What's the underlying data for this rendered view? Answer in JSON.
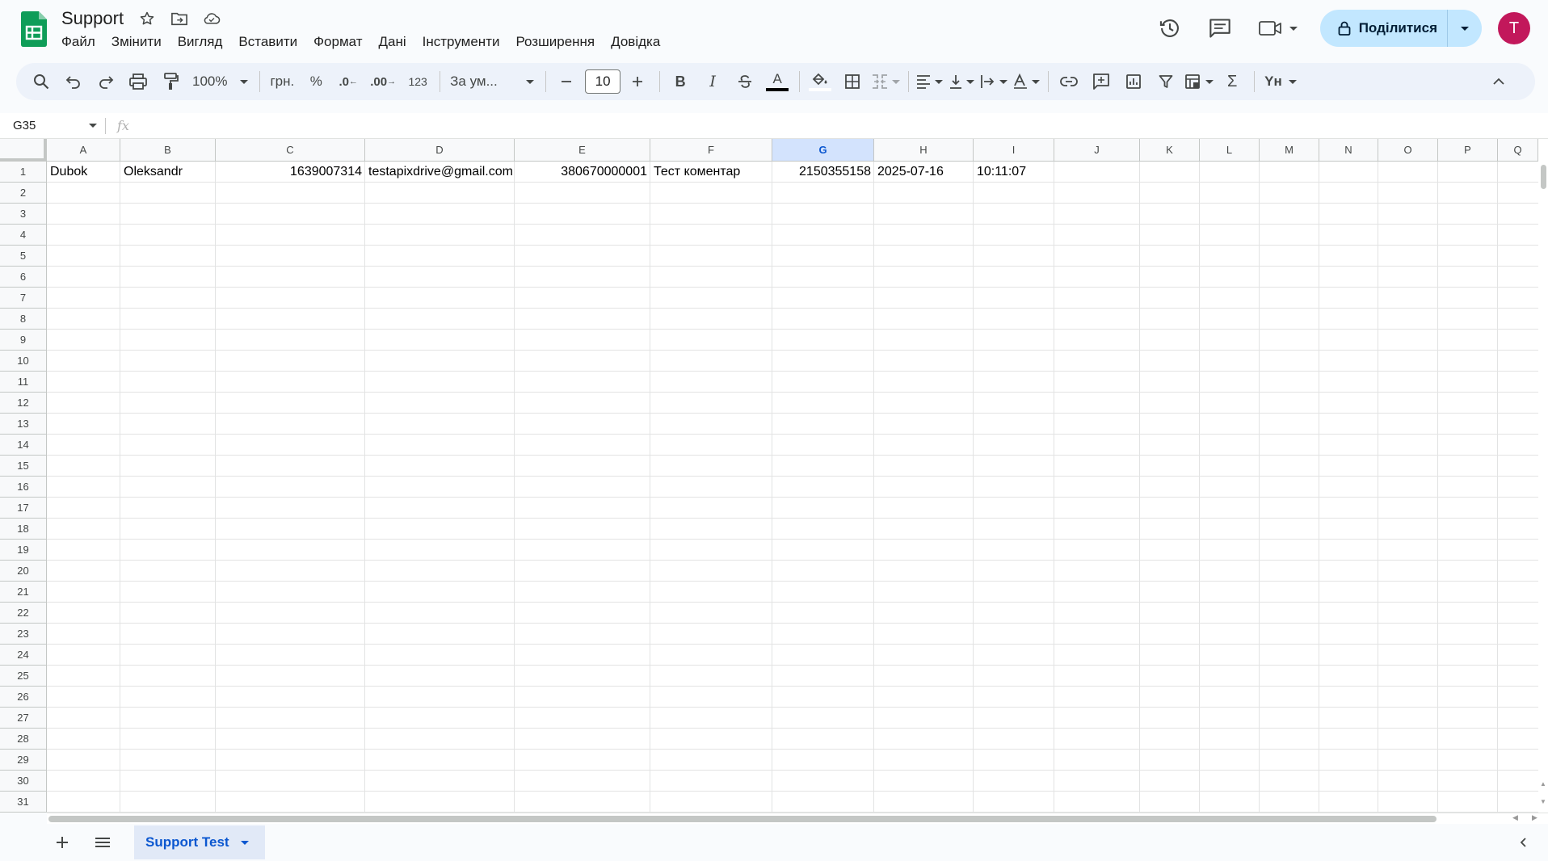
{
  "header": {
    "title": "Support",
    "menu": [
      "Файл",
      "Змінити",
      "Вигляд",
      "Вставити",
      "Формат",
      "Дані",
      "Інструменти",
      "Розширення",
      "Довідка"
    ],
    "share_label": "Поділитися",
    "avatar_letter": "T"
  },
  "toolbar": {
    "zoom": "100%",
    "currency": "грн.",
    "percent": "%",
    "dec_minus": ".0",
    "dec_plus": ".00",
    "num_format": "123",
    "font": "За ум...",
    "font_size": "10",
    "bold": "B",
    "italic": "I",
    "text_color": "A",
    "lang_tool": "Yн"
  },
  "formula_bar": {
    "name_box": "G35",
    "fx": "fx"
  },
  "columns": [
    "A",
    "B",
    "C",
    "D",
    "E",
    "F",
    "G",
    "H",
    "I",
    "J",
    "K",
    "L",
    "M",
    "N",
    "O",
    "P",
    "Q"
  ],
  "selected_column": "G",
  "rows": [
    "1",
    "2",
    "3",
    "4",
    "5",
    "6",
    "7",
    "8",
    "9",
    "10",
    "11",
    "12",
    "13",
    "14",
    "15",
    "16",
    "17",
    "18",
    "19",
    "20",
    "21",
    "22",
    "23",
    "24",
    "25",
    "26",
    "27",
    "28",
    "29",
    "30",
    "31"
  ],
  "row1": {
    "a": "Dubok",
    "b": "Oleksandr",
    "c": "1639007314",
    "d": "testapixdrive@gmail.com",
    "e": "380670000001",
    "f": "Тест коментар",
    "g": "2150355158",
    "h": "2025-07-16",
    "i": "10:11:07"
  },
  "sheets": {
    "active": "Support Test"
  },
  "colors": {
    "accent": "#0b57d0",
    "share_bg": "#c2e7ff",
    "avatar": "#c2185b",
    "sheets_green": "#0f9d58"
  }
}
